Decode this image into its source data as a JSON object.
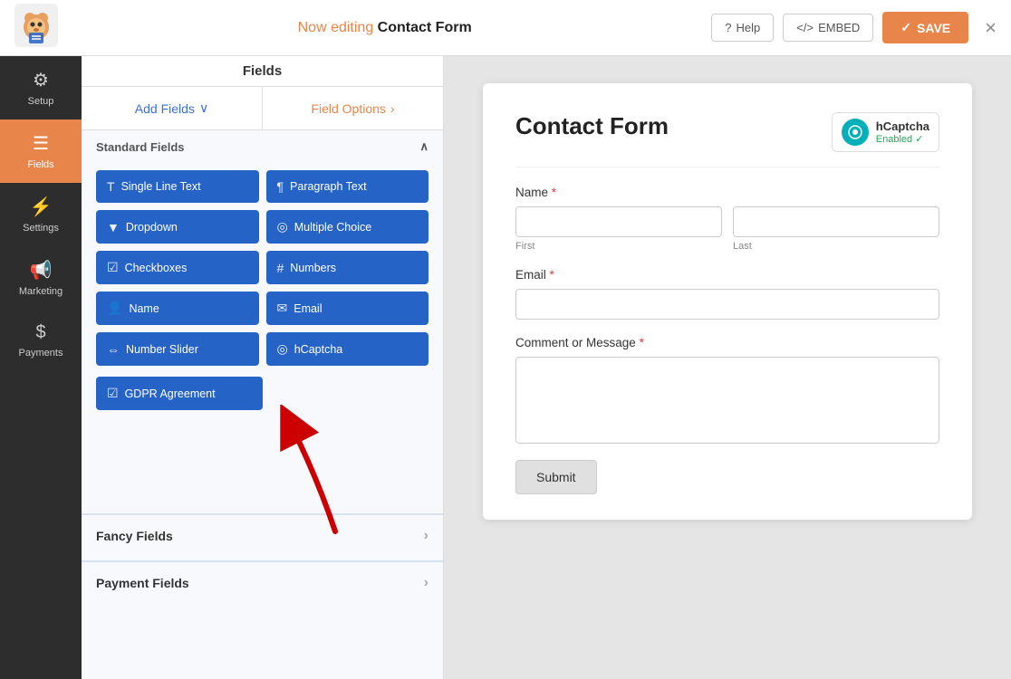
{
  "topbar": {
    "now_editing_label": "Now editing",
    "form_name": "Contact Form",
    "help_label": "Help",
    "embed_label": "EMBED",
    "save_label": "SAVE",
    "close_label": "×"
  },
  "nav": {
    "items": [
      {
        "id": "setup",
        "label": "Setup",
        "icon": "⚙"
      },
      {
        "id": "fields",
        "label": "Fields",
        "icon": "☰",
        "active": true
      },
      {
        "id": "settings",
        "label": "Settings",
        "icon": "⚡"
      },
      {
        "id": "marketing",
        "label": "Marketing",
        "icon": "📢"
      },
      {
        "id": "payments",
        "label": "Payments",
        "icon": "$"
      }
    ]
  },
  "panel": {
    "title": "Fields",
    "tabs": [
      {
        "id": "add-fields",
        "label": "Add Fields",
        "chevron": "∨"
      },
      {
        "id": "field-options",
        "label": "Field Options",
        "chevron": ">"
      }
    ],
    "standard_fields": {
      "title": "Standard Fields",
      "buttons": [
        {
          "id": "single-line-text",
          "label": "Single Line Text",
          "icon": "T"
        },
        {
          "id": "paragraph-text",
          "label": "Paragraph Text",
          "icon": "¶"
        },
        {
          "id": "dropdown",
          "label": "Dropdown",
          "icon": "▼"
        },
        {
          "id": "multiple-choice",
          "label": "Multiple Choice",
          "icon": "◎"
        },
        {
          "id": "checkboxes",
          "label": "Checkboxes",
          "icon": "☑"
        },
        {
          "id": "numbers",
          "label": "Numbers",
          "icon": "#"
        },
        {
          "id": "name",
          "label": "Name",
          "icon": "👤"
        },
        {
          "id": "email",
          "label": "Email",
          "icon": "✉"
        },
        {
          "id": "number-slider",
          "label": "Number Slider",
          "icon": "⇔"
        },
        {
          "id": "hcaptcha",
          "label": "hCaptcha",
          "icon": "◎"
        },
        {
          "id": "gdpr-agreement",
          "label": "GDPR Agreement",
          "icon": "☑"
        }
      ]
    },
    "fancy_fields": {
      "title": "Fancy Fields"
    },
    "payment_fields": {
      "title": "Payment Fields"
    }
  },
  "form_preview": {
    "title": "Contact Form",
    "hcaptcha": {
      "label": "hCaptcha",
      "status": "Enabled"
    },
    "fields": [
      {
        "id": "name",
        "label": "Name",
        "required": true,
        "type": "name",
        "subfields": [
          "First",
          "Last"
        ]
      },
      {
        "id": "email",
        "label": "Email",
        "required": true,
        "type": "email"
      },
      {
        "id": "comment",
        "label": "Comment or Message",
        "required": true,
        "type": "textarea"
      }
    ],
    "submit_label": "Submit"
  }
}
